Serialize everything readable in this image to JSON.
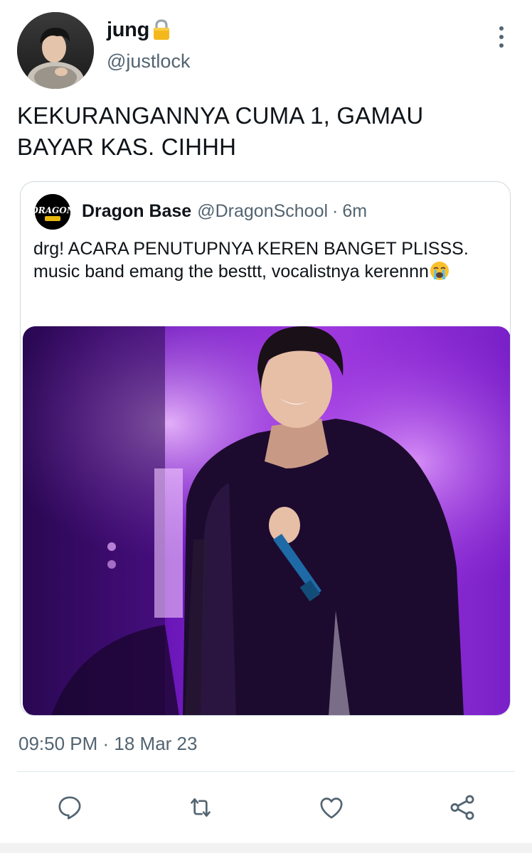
{
  "tweet": {
    "display_name": "jung",
    "lock_icon": "lock-icon",
    "handle": "@justlock",
    "text": "KEKURANGANNYA CUMA 1, GAMAU BAYAR KAS. CIHHH",
    "timestamp": "09:50 PM · 18 Mar 23"
  },
  "quoted": {
    "avatar_text": "DRAGON",
    "name": "Dragon Base",
    "handle": "@DragonSchool",
    "separator": "·",
    "time": "6m",
    "text": "drg! ACARA PENUTUPNYA KEREN BANGET PLISSS. music band emang the besttt, vocalistnya kerennn",
    "emoji": "loudly-crying-face-emoji"
  },
  "actions": [
    {
      "name": "reply",
      "icon": "reply-icon"
    },
    {
      "name": "retweet",
      "icon": "retweet-icon"
    },
    {
      "name": "like",
      "icon": "heart-icon"
    },
    {
      "name": "share",
      "icon": "share-icon"
    }
  ],
  "colors": {
    "text": "#0f1419",
    "muted": "#536471",
    "border": "#cfd9de",
    "lock": "#f5b81c"
  }
}
